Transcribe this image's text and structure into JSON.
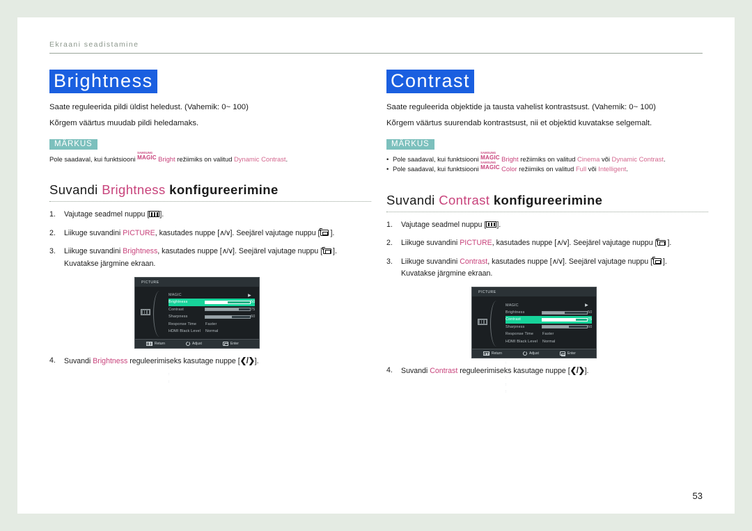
{
  "header": {
    "breadcrumb": "Ekraani seadistamine"
  },
  "page_number": "53",
  "colors": {
    "title_highlight_bg": "#1a5fe0",
    "note_badge_bg": "#7cc0bd",
    "keyword_pink": "#c8447c",
    "osd_highlight": "#17d39a"
  },
  "left": {
    "title": "Brightness",
    "paragraphs": [
      "Saate reguleerida pildi üldist heledust. (Vahemik: 0~ 100)",
      "Kõrgem väärtus muudab pildi heledamaks."
    ],
    "note": {
      "badge": "MÄRKUS",
      "lines": [
        {
          "pre": "Pole saadaval, kui funktsiooni ",
          "magic_top": "SAMSUNG",
          "magic_bottom": "MAGIC",
          "magic_suffix": "Bright",
          "mid": " režiimiks on valitud ",
          "value1": "Dynamic Contrast",
          "post": "."
        }
      ]
    },
    "subhead": {
      "prefix": "Suvandi ",
      "keyword": "Brightness",
      "suffix": " konfigureerimine"
    },
    "steps": [
      {
        "num": "1.",
        "pre": "Vajutage seadmel nuppu [",
        "post": "]."
      },
      {
        "num": "2.",
        "pre": "Liikuge suvandini ",
        "kw": "PICTURE",
        "mid": ", kasutades nuppe [",
        "mid2": "]. Seejärel vajutage nuppu [",
        "post": "]."
      },
      {
        "num": "3.",
        "pre": "Liikuge suvandini ",
        "kw": "Brightness",
        "mid": ", kasutades nuppe [",
        "mid2": "]. Seejärel vajutage nuppu [",
        "post": "].",
        "sub": "Kuvatakse järgmine ekraan."
      }
    ],
    "step4": {
      "num": "4.",
      "pre": "Suvandi ",
      "kw": "Brightness",
      "mid": " reguleerimiseks kasutage nuppe [",
      "post": "]."
    },
    "osd": {
      "title": "PICTURE",
      "rows": [
        {
          "label": "MAGIC",
          "type": "arrow",
          "arrow": "▶",
          "highlight": false
        },
        {
          "label": "Brightness",
          "type": "bar",
          "value": "50",
          "percent": 50,
          "highlight": true
        },
        {
          "label": "Contrast",
          "type": "bar",
          "value": "75",
          "percent": 75,
          "highlight": false
        },
        {
          "label": "Sharpness",
          "type": "bar",
          "value": "60",
          "percent": 60,
          "highlight": false
        },
        {
          "label": "Response Time",
          "type": "text",
          "value": "Faster",
          "highlight": false
        },
        {
          "label": "HDMI Black Level",
          "type": "text",
          "value": "Normal",
          "highlight": false
        }
      ],
      "footer": [
        "Return",
        "Adjust",
        "Enter"
      ]
    }
  },
  "right": {
    "title": "Contrast",
    "paragraphs": [
      "Saate reguleerida objektide ja tausta vahelist kontrastsust. (Vahemik: 0~ 100)",
      "Kõrgem väärtus suurendab kontrastsust, nii et objektid kuvatakse selgemalt."
    ],
    "note": {
      "badge": "MÄRKUS",
      "lines": [
        {
          "pre": "Pole saadaval, kui funktsiooni ",
          "magic_top": "SAMSUNG",
          "magic_bottom": "MAGIC",
          "magic_suffix": "Bright",
          "mid": " režiimiks on valitud ",
          "value1": "Cinema",
          "conj": " või ",
          "value2": "Dynamic Contrast",
          "post": "."
        },
        {
          "pre": "Pole saadaval, kui funktsiooni ",
          "magic_top": "SAMSUNG",
          "magic_bottom": "MAGIC",
          "magic_suffix": "Color",
          "mid": " režiimiks on valitud ",
          "value1": "Full",
          "conj": " või ",
          "value2": "Intelligent",
          "post": "."
        }
      ]
    },
    "subhead": {
      "prefix": "Suvandi ",
      "keyword": "Contrast",
      "suffix": " konfigureerimine"
    },
    "steps": [
      {
        "num": "1.",
        "pre": "Vajutage seadmel nuppu [",
        "post": "]."
      },
      {
        "num": "2.",
        "pre": "Liikuge suvandini ",
        "kw": "PICTURE",
        "mid": ", kasutades nuppe [",
        "mid2": "]. Seejärel vajutage nuppu [",
        "post": "]."
      },
      {
        "num": "3.",
        "pre": "Liikuge suvandini ",
        "kw": "Contrast",
        "mid": ", kasutades nuppe [",
        "mid2": "]. Seejärel vajutage nuppu [",
        "post": "].",
        "sub": "Kuvatakse järgmine ekraan."
      }
    ],
    "step4": {
      "num": "4.",
      "pre": "Suvandi ",
      "kw": "Contrast",
      "mid": " reguleerimiseks kasutage nuppe [",
      "post": "]."
    },
    "osd": {
      "title": "PICTURE",
      "rows": [
        {
          "label": "MAGIC",
          "type": "arrow",
          "arrow": "▶",
          "highlight": false
        },
        {
          "label": "Brightness",
          "type": "bar",
          "value": "50",
          "percent": 50,
          "highlight": false
        },
        {
          "label": "Contrast",
          "type": "bar",
          "value": "75",
          "percent": 75,
          "highlight": true
        },
        {
          "label": "Sharpness",
          "type": "bar",
          "value": "60",
          "percent": 60,
          "highlight": false
        },
        {
          "label": "Response Time",
          "type": "text",
          "value": "Faster",
          "highlight": false
        },
        {
          "label": "HDMI Black Level",
          "type": "text",
          "value": "Normal",
          "highlight": false
        }
      ],
      "footer": [
        "Return",
        "Adjust",
        "Enter"
      ]
    }
  }
}
